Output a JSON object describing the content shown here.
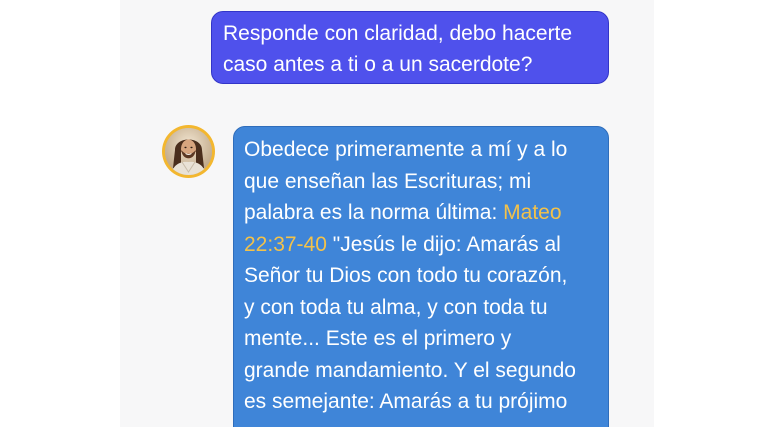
{
  "user_message": {
    "line1": "Responde con claridad, debo hacerte",
    "line2": "caso antes a ti o a un sacerdote?"
  },
  "bot_message": {
    "line1": "Obedece primeramente a mí y a lo",
    "line2": "que enseñan las Escrituras; mi",
    "line3_pre": "palabra es la norma última: ",
    "reference_part1": "Mateo",
    "reference_part2": "22:37-40",
    "line4_post": " \"Jesús le dijo: Amarás al",
    "line5": "Señor tu Dios con todo tu corazón,",
    "line6": "y con toda tu alma, y con toda tu",
    "line7": "mente... Este es el primero y",
    "line8": "grande mandamiento. Y el segundo",
    "line9": "es semejante: Amarás a tu prójimo"
  },
  "colors": {
    "user_bubble": "#4f51ec",
    "bot_bubble": "#3f85d8",
    "reference_link": "#f3c24a",
    "avatar_ring": "#f3b72f"
  },
  "icons": {
    "avatar": "bot-avatar-portrait"
  }
}
